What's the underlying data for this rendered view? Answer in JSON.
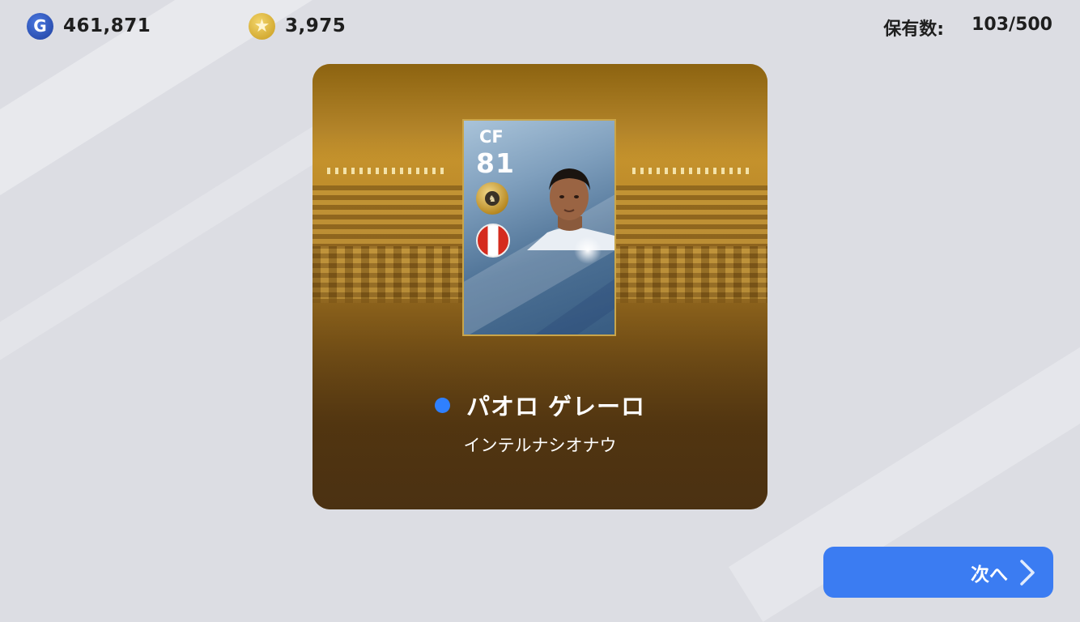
{
  "topbar": {
    "gp": {
      "icon": "gp-icon",
      "icon_letter": "G",
      "value": "461,871"
    },
    "coins": {
      "icon": "star-coin-icon",
      "icon_glyph": "★",
      "value": "3,975"
    },
    "owned": {
      "label": "保有数:",
      "value": "103/500"
    }
  },
  "card": {
    "position": "CF",
    "rating": "81",
    "badge_icon": "club-badge-icon",
    "badge_glyph": "♞",
    "flag_icon": "peru-flag-icon"
  },
  "player": {
    "name": "パオロ ゲレーロ",
    "team": "インテルナシオナウ",
    "indicator_color": "#2f80ff"
  },
  "actions": {
    "next_label": "次へ",
    "next_icon": "chevron-right-icon"
  },
  "colors": {
    "accent_blue": "#3b7cf2",
    "panel_gold": "#c9962c",
    "panel_brown": "#4c3210"
  }
}
